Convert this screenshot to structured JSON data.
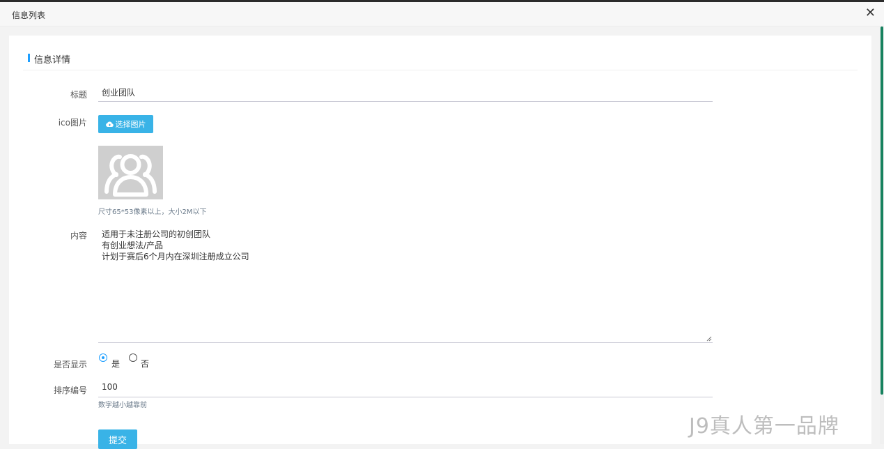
{
  "window": {
    "title": "信息列表",
    "close_icon": "close-icon"
  },
  "section": {
    "title": "信息详情"
  },
  "form": {
    "title_label": "标题",
    "title_value": "创业团队",
    "icon_label": "ico图片",
    "upload_button": "选择图片",
    "upload_icon": "cloud-upload-icon",
    "image_size_hint": "尺寸65*53像素以上，大小2M以下",
    "content_label": "内容",
    "content_lines": [
      "适用于未注册公司的初创团队",
      "有创业想法/产品",
      "计划于赛后6个月内在深圳注册成立公司"
    ],
    "display_label": "是否显示",
    "display_options": [
      "是",
      "否"
    ],
    "display_selected": "是",
    "order_label": "排序编号",
    "order_value": "100",
    "order_hint": "数字越小越靠前",
    "submit_button": "提交"
  },
  "watermark": "J9真人第一品牌",
  "colors": {
    "accent": "#1e9fff",
    "button": "#39b3e7",
    "scrollbar": "#17825f"
  }
}
